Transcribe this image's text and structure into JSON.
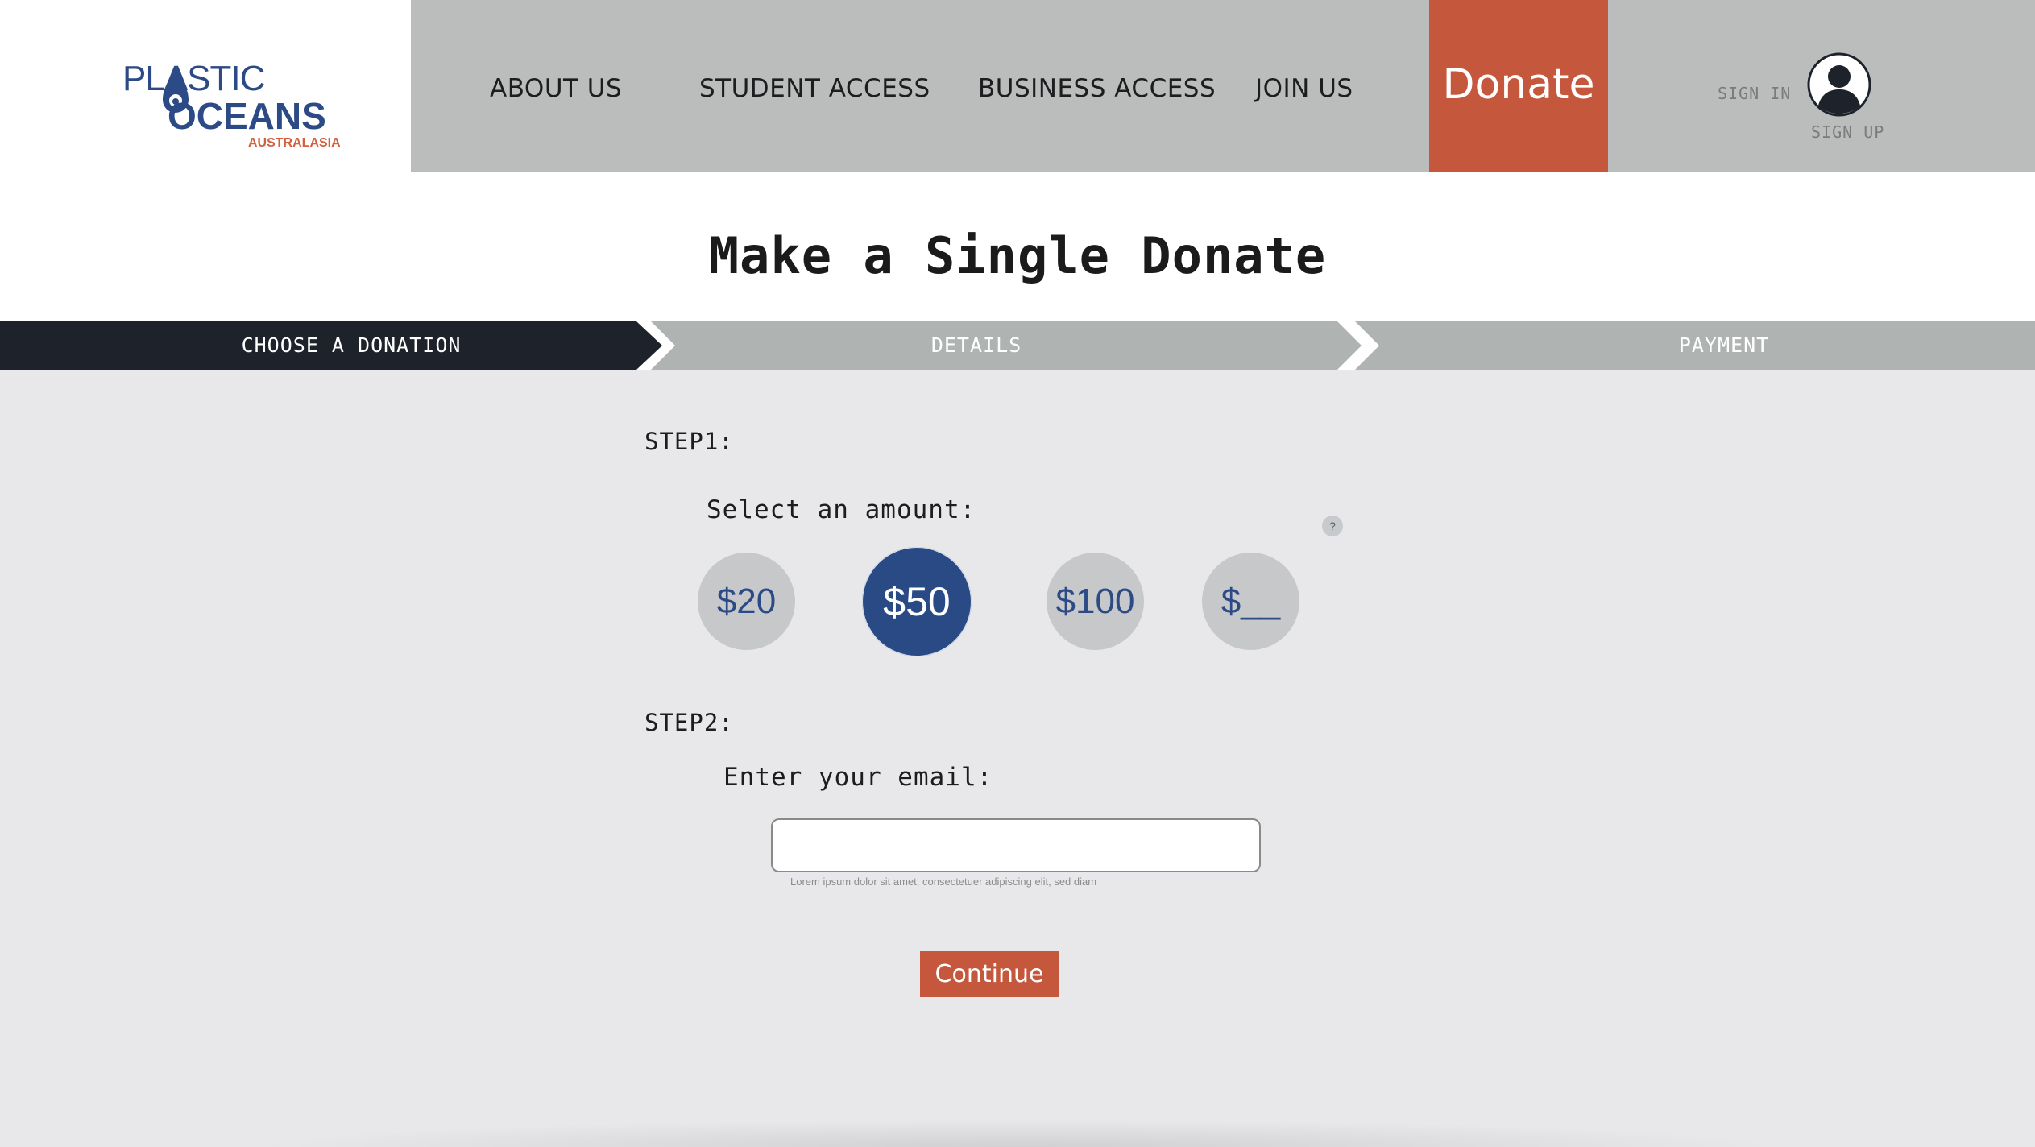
{
  "brand": {
    "logo_line1": "PLASTIC",
    "logo_line2": "OCEANS",
    "logo_line3": "AUSTRALASIA",
    "primary_color": "#2c4a86",
    "accent_color": "#c5573d"
  },
  "nav": {
    "items": [
      {
        "label": "ABOUT US"
      },
      {
        "label": "STUDENT ACCESS"
      },
      {
        "label": "BUSINESS ACCESS"
      },
      {
        "label": "JOIN US"
      }
    ],
    "donate_label": "Donate",
    "sign_in_label": "SIGN IN",
    "sign_up_label": "SIGN UP",
    "avatar_icon": "user-avatar-icon"
  },
  "page": {
    "title": "Make a Single Donate"
  },
  "stepper": {
    "steps": [
      {
        "label": "CHOOSE A DONATION",
        "active": true
      },
      {
        "label": "DETAILS",
        "active": false
      },
      {
        "label": "PAYMENT",
        "active": false
      }
    ],
    "active_color": "#1e222a",
    "inactive_color": "#afb3b2"
  },
  "step1": {
    "heading": "STEP1:",
    "prompt": "Select an amount:",
    "help_icon": "question-icon",
    "help_label": "?",
    "amounts": [
      {
        "label": "$20",
        "selected": false
      },
      {
        "label": "$50",
        "selected": true
      },
      {
        "label": "$100",
        "selected": false
      },
      {
        "label": "$__",
        "selected": false
      }
    ]
  },
  "step2": {
    "heading": "STEP2:",
    "prompt": "Enter your email:",
    "email_value": "",
    "email_placeholder": "",
    "helper_text": "Lorem ipsum dolor sit amet, consectetuer adipiscing elit, sed diam"
  },
  "actions": {
    "continue_label": "Continue"
  }
}
